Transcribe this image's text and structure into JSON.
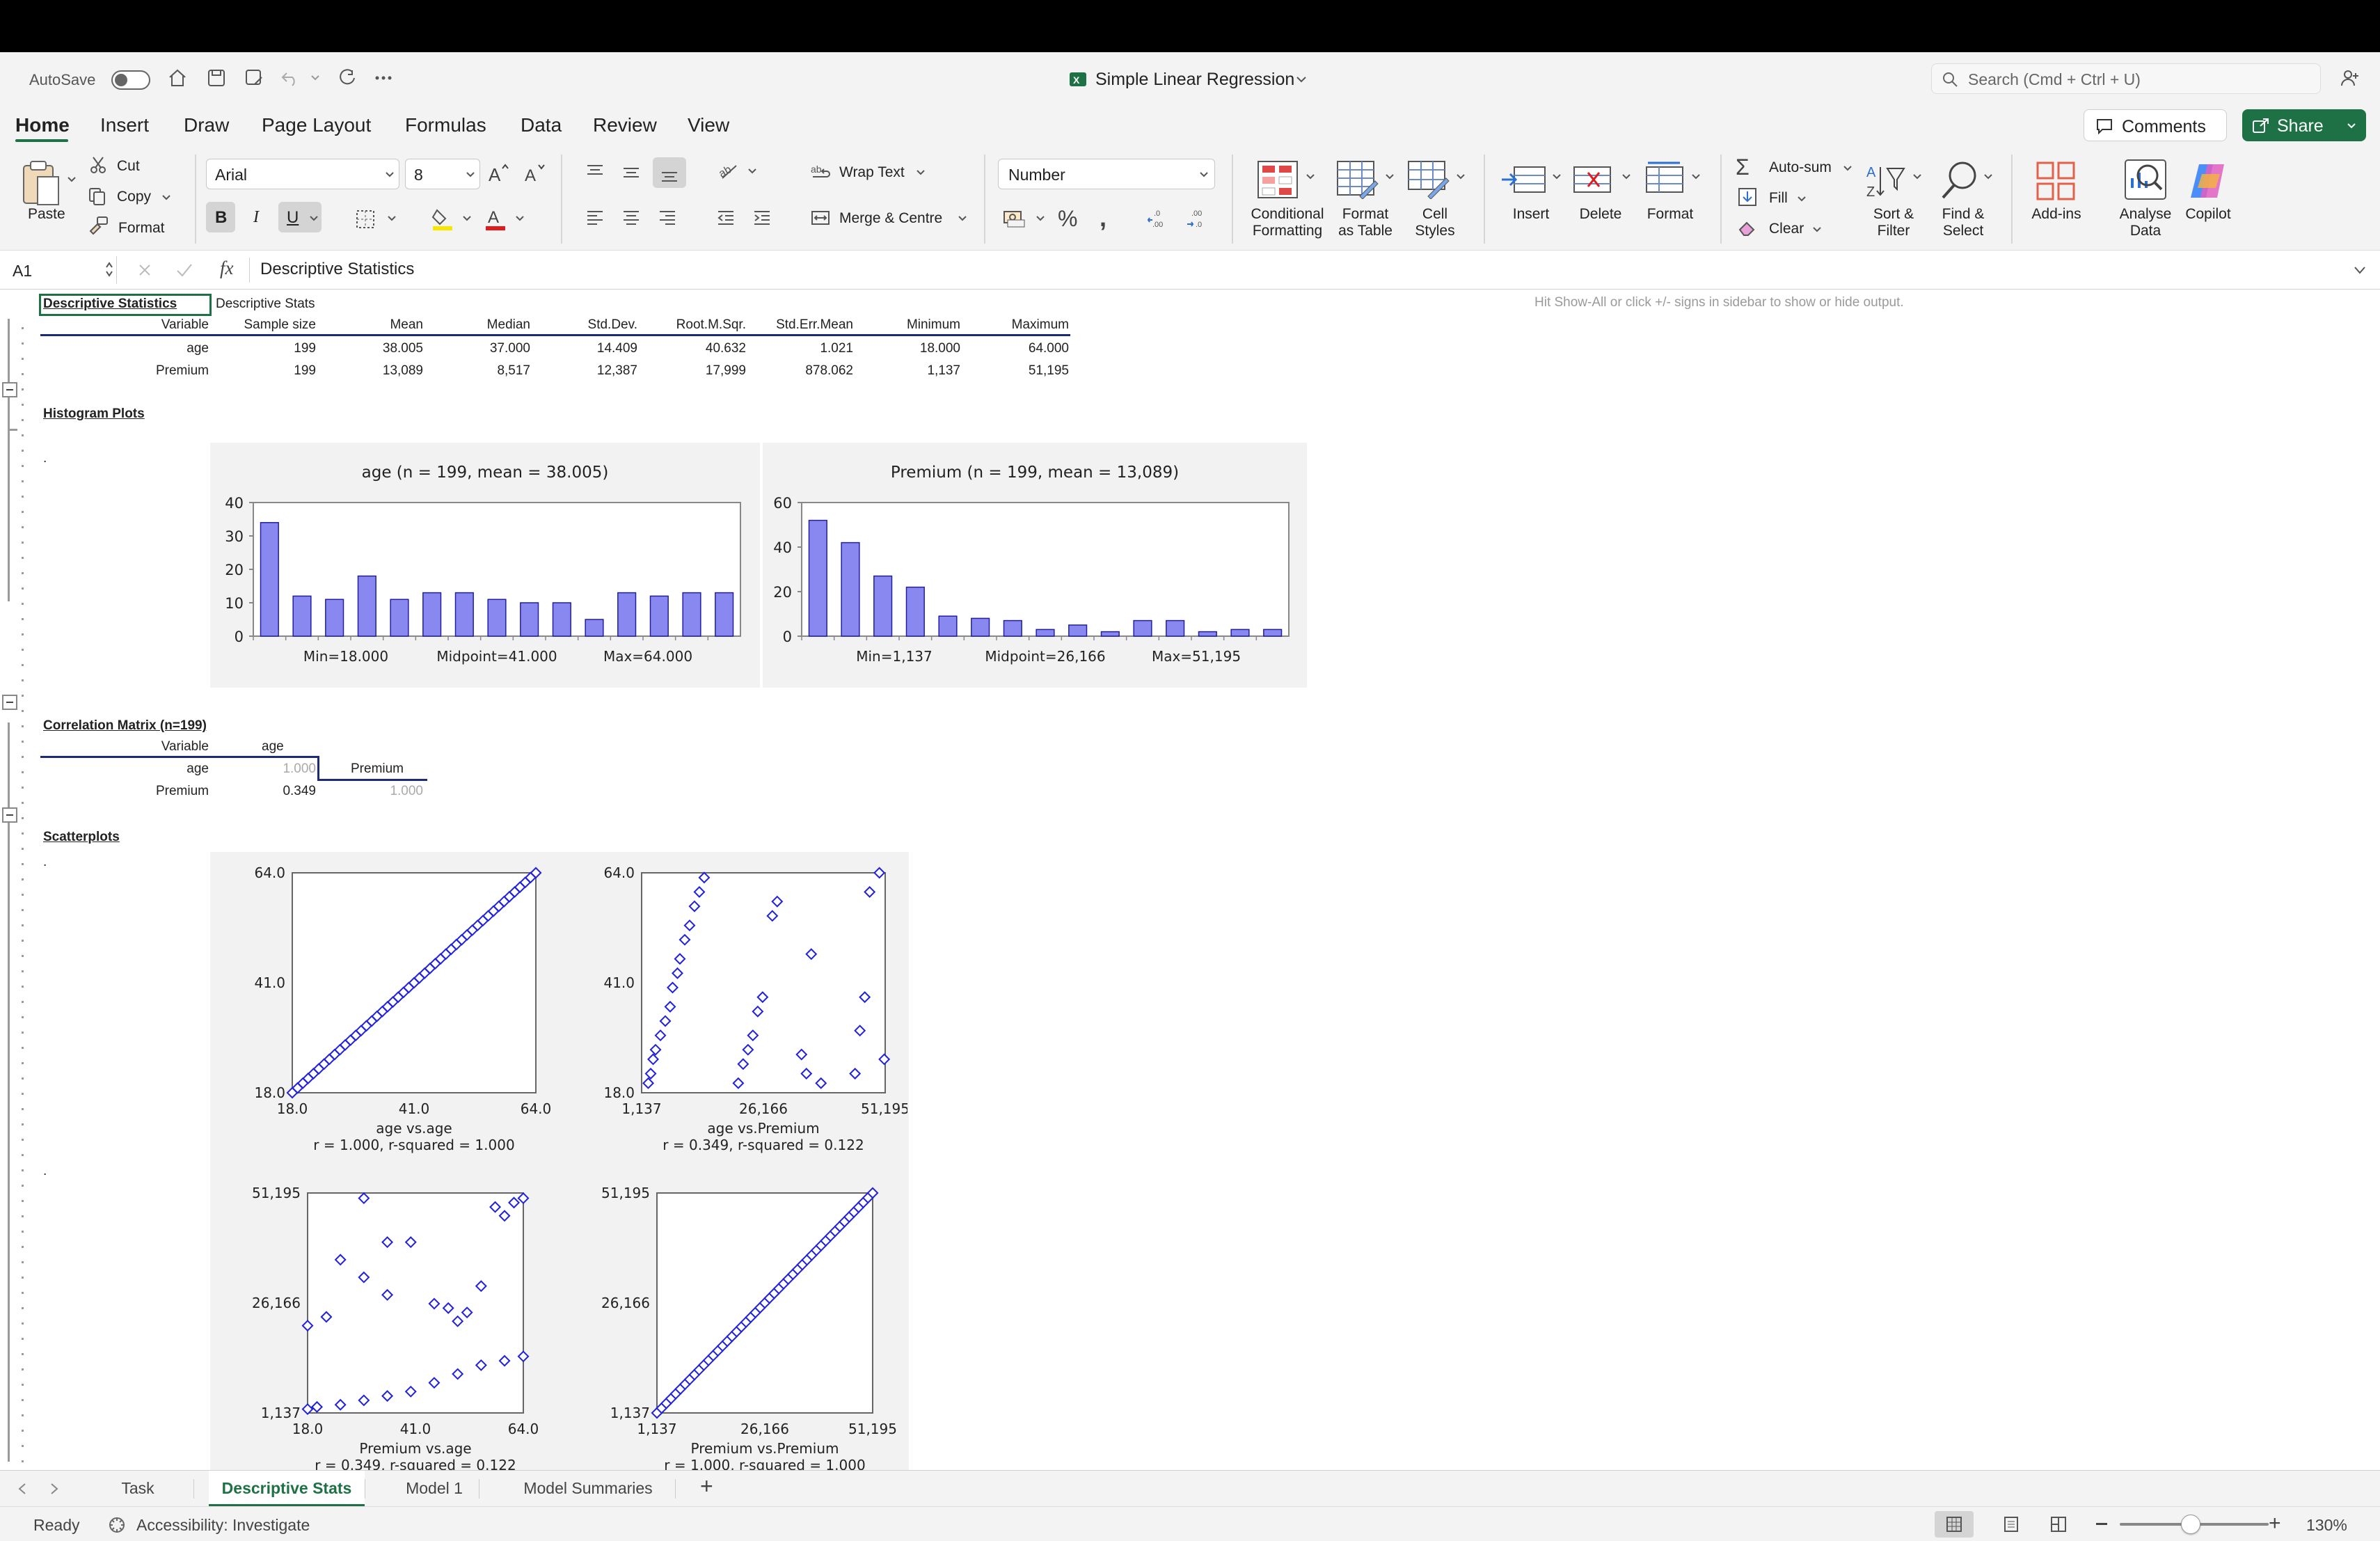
{
  "app": {
    "autosave": "AutoSave",
    "title": "Simple Linear Regression",
    "search_placeholder": "Search (Cmd + Ctrl + U)"
  },
  "menu": {
    "tabs": [
      "Home",
      "Insert",
      "Draw",
      "Page Layout",
      "Formulas",
      "Data",
      "Review",
      "View"
    ],
    "comments": "Comments",
    "share": "Share"
  },
  "ribbon": {
    "paste": "Paste",
    "cut": "Cut",
    "copy": "Copy",
    "format_painter": "Format",
    "font_name": "Arial",
    "font_size": "8",
    "wrap_text": "Wrap Text",
    "merge_centre": "Merge & Centre",
    "number_format": "Number",
    "conditional_formatting": [
      "Conditional",
      "Formatting"
    ],
    "format_as_table": [
      "Format",
      "as Table"
    ],
    "cell_styles": [
      "Cell",
      "Styles"
    ],
    "insert": "Insert",
    "delete": "Delete",
    "format": "Format",
    "autosum": "Auto-sum",
    "fill": "Fill",
    "clear": "Clear",
    "sort_filter": [
      "Sort &",
      "Filter"
    ],
    "find_select": [
      "Find &",
      "Select"
    ],
    "addins": "Add-ins",
    "analyse_data": [
      "Analyse",
      "Data"
    ],
    "copilot": "Copilot",
    "accent_color": "#1e7145"
  },
  "formula_bar": {
    "cell_ref": "A1",
    "fx": "fx",
    "content": "Descriptive Statistics"
  },
  "sheet": {
    "hint": "Hit Show-All or click +/- signs in sidebar to show or hide output.",
    "desc_title": "Descriptive Statistics",
    "desc_sheetname": "Descriptive Stats",
    "desc_headers": [
      "Variable",
      "Sample size",
      "Mean",
      "Median",
      "Std.Dev.",
      "Root.M.Sqr.",
      "Std.Err.Mean",
      "Minimum",
      "Maximum"
    ],
    "desc_rows": [
      [
        "age",
        "199",
        "38.005",
        "37.000",
        "14.409",
        "40.632",
        "1.021",
        "18.000",
        "64.000"
      ],
      [
        "Premium",
        "199",
        "13,089",
        "8,517",
        "12,387",
        "17,999",
        "878.062",
        "1,137",
        "51,195"
      ]
    ],
    "hist_title": "Histogram Plots",
    "corr_title": "Correlation Matrix (n=199)",
    "corr": {
      "h_variable": "Variable",
      "h_age": "age",
      "r1_label": "age",
      "r1_v1": "1.000",
      "r1_h2": "Premium",
      "r2_label": "Premium",
      "r2_v1": "0.349",
      "r2_v2": "1.000"
    },
    "scatter_title": "Scatterplots",
    "dot": "."
  },
  "charts": {
    "hist_age": {
      "title": "age  (n = 199, mean = 38.005)",
      "ticks": [
        "40",
        "30",
        "20",
        "10",
        "0"
      ],
      "labels": [
        "Min=18.000",
        "Midpoint=41.000",
        "Max=64.000"
      ]
    },
    "hist_premium": {
      "title": "Premium  (n = 199, mean = 13,089)",
      "ticks": [
        "60",
        "40",
        "20",
        "0"
      ],
      "labels": [
        "Min=1,137",
        "Midpoint=26,166",
        "Max=51,195"
      ]
    },
    "sc1": {
      "y": [
        "64.0",
        "41.0",
        "18.0"
      ],
      "x": [
        "18.0",
        "41.0",
        "64.0"
      ],
      "cap1": "age vs.age",
      "cap2": "r = 1.000,  r-squared = 1.000"
    },
    "sc2": {
      "y": [
        "64.0",
        "41.0",
        "18.0"
      ],
      "x": [
        "1,137",
        "26,166",
        "51,195"
      ],
      "cap1": "age vs.Premium",
      "cap2": "r = 0.349,  r-squared = 0.122"
    },
    "sc3": {
      "y": [
        "51,195",
        "26,166",
        "1,137"
      ],
      "x": [
        "18.0",
        "41.0",
        "64.0"
      ],
      "cap1": "Premium vs.age",
      "cap2": "r = 0.349,  r-squared = 0.122"
    },
    "sc4": {
      "y": [
        "51,195",
        "26,166",
        "1,137"
      ],
      "x": [
        "1,137",
        "26,166",
        "51,195"
      ],
      "cap1": "Premium vs.Premium",
      "cap2": "r = 1.000,  r-squared = 1.000"
    }
  },
  "chart_data": [
    {
      "type": "bar",
      "title": "age  (n = 199, mean = 38.005)",
      "ylim": [
        0,
        40
      ],
      "values": [
        34,
        12,
        11,
        18,
        11,
        13,
        13,
        11,
        10,
        10,
        5,
        13,
        12,
        13,
        13
      ],
      "bar_color": "#8888f0"
    },
    {
      "type": "bar",
      "title": "Premium  (n = 199, mean = 13,089)",
      "ylim": [
        0,
        60
      ],
      "values": [
        52,
        42,
        27,
        22,
        9,
        8,
        7,
        3,
        5,
        2,
        7,
        7,
        2,
        3,
        3
      ],
      "bar_color": "#8888f0"
    },
    {
      "type": "scatter",
      "xlabel": "age",
      "ylabel": "age",
      "xlim": [
        18,
        64
      ],
      "ylim": [
        18,
        64
      ]
    },
    {
      "type": "scatter",
      "xlabel": "Premium",
      "ylabel": "age",
      "xlim": [
        1137,
        51195
      ],
      "ylim": [
        18,
        64
      ],
      "points": [
        [
          2500,
          20
        ],
        [
          3000,
          22
        ],
        [
          3500,
          25
        ],
        [
          4000,
          27
        ],
        [
          5000,
          30
        ],
        [
          6000,
          33
        ],
        [
          7000,
          36
        ],
        [
          7500,
          40
        ],
        [
          8500,
          43
        ],
        [
          9000,
          46
        ],
        [
          10000,
          50
        ],
        [
          11000,
          53
        ],
        [
          12000,
          57
        ],
        [
          13000,
          60
        ],
        [
          14000,
          63
        ],
        [
          21000,
          20
        ],
        [
          22000,
          24
        ],
        [
          23000,
          27
        ],
        [
          24000,
          30
        ],
        [
          25000,
          35
        ],
        [
          26000,
          38
        ],
        [
          28000,
          55
        ],
        [
          29000,
          58
        ],
        [
          34000,
          26
        ],
        [
          35000,
          22
        ],
        [
          36000,
          47
        ],
        [
          38000,
          20
        ],
        [
          45000,
          22
        ],
        [
          46000,
          31
        ],
        [
          47000,
          38
        ],
        [
          48000,
          60
        ],
        [
          50000,
          64
        ],
        [
          51000,
          25
        ]
      ]
    },
    {
      "type": "scatter",
      "xlabel": "age",
      "ylabel": "Premium",
      "xlim": [
        18,
        64
      ],
      "ylim": [
        1137,
        51195
      ],
      "points": [
        [
          18,
          2000
        ],
        [
          20,
          2500
        ],
        [
          25,
          3000
        ],
        [
          30,
          4000
        ],
        [
          35,
          5000
        ],
        [
          40,
          6000
        ],
        [
          45,
          8000
        ],
        [
          50,
          10000
        ],
        [
          55,
          12000
        ],
        [
          60,
          13000
        ],
        [
          64,
          14000
        ],
        [
          18,
          21000
        ],
        [
          22,
          23000
        ],
        [
          25,
          36000
        ],
        [
          30,
          32000
        ],
        [
          35,
          28000
        ],
        [
          40,
          40000
        ],
        [
          45,
          26000
        ],
        [
          50,
          22000
        ],
        [
          55,
          30000
        ],
        [
          58,
          48000
        ],
        [
          60,
          46000
        ],
        [
          62,
          49000
        ],
        [
          64,
          50000
        ],
        [
          30,
          50000
        ],
        [
          35,
          40000
        ],
        [
          48,
          25000
        ],
        [
          52,
          24000
        ]
      ]
    },
    {
      "type": "scatter",
      "xlabel": "Premium",
      "ylabel": "Premium",
      "xlim": [
        1137,
        51195
      ],
      "ylim": [
        1137,
        51195
      ]
    }
  ],
  "sheet_tabs": {
    "tabs": [
      "Task",
      "Descriptive Stats",
      "Model 1",
      "Model Summaries"
    ],
    "active": "Descriptive Stats",
    "add": "+"
  },
  "status": {
    "ready": "Ready",
    "accessibility": "Accessibility: Investigate",
    "zoom": "130%"
  }
}
